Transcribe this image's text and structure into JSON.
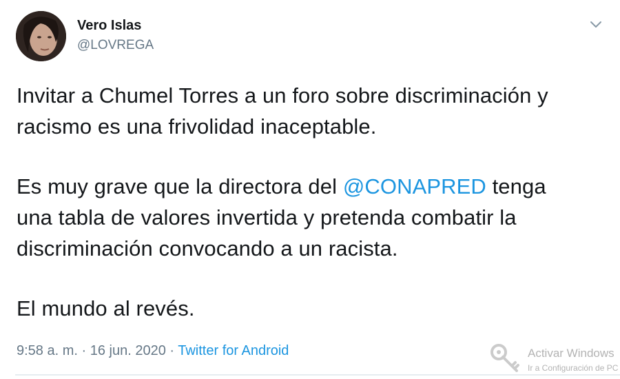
{
  "tweet": {
    "author": {
      "display_name": "Vero Islas",
      "handle": "@LOVREGA"
    },
    "menu_icon": "chevron-down-icon",
    "body": {
      "p1_line1": "Invitar a Chumel Torres a un foro sobre discriminación y",
      "p1_line2": "racismo es una frivolidad inaceptable.",
      "p2_line1_before": "Es muy grave que la directora del ",
      "p2_mention": "@CONAPRED",
      "p2_line1_after": " tenga",
      "p2_line2": "una tabla de valores invertida y pretenda combatir la",
      "p2_line3": "discriminación convocando a un racista.",
      "p3_line1": "El mundo al revés."
    },
    "meta": {
      "time": "9:58 a. m.",
      "sep1": " · ",
      "date": "16 jun. 2020",
      "sep2": " · ",
      "source": "Twitter for Android"
    }
  },
  "watermark": {
    "title": "Activar Windows",
    "subtitle": "Ir a Configuración de PC para activar Windows.",
    "icon": "key-icon"
  },
  "colors": {
    "link": "#1b95e0",
    "secondary_text": "#657786",
    "primary_text": "#14171a"
  }
}
